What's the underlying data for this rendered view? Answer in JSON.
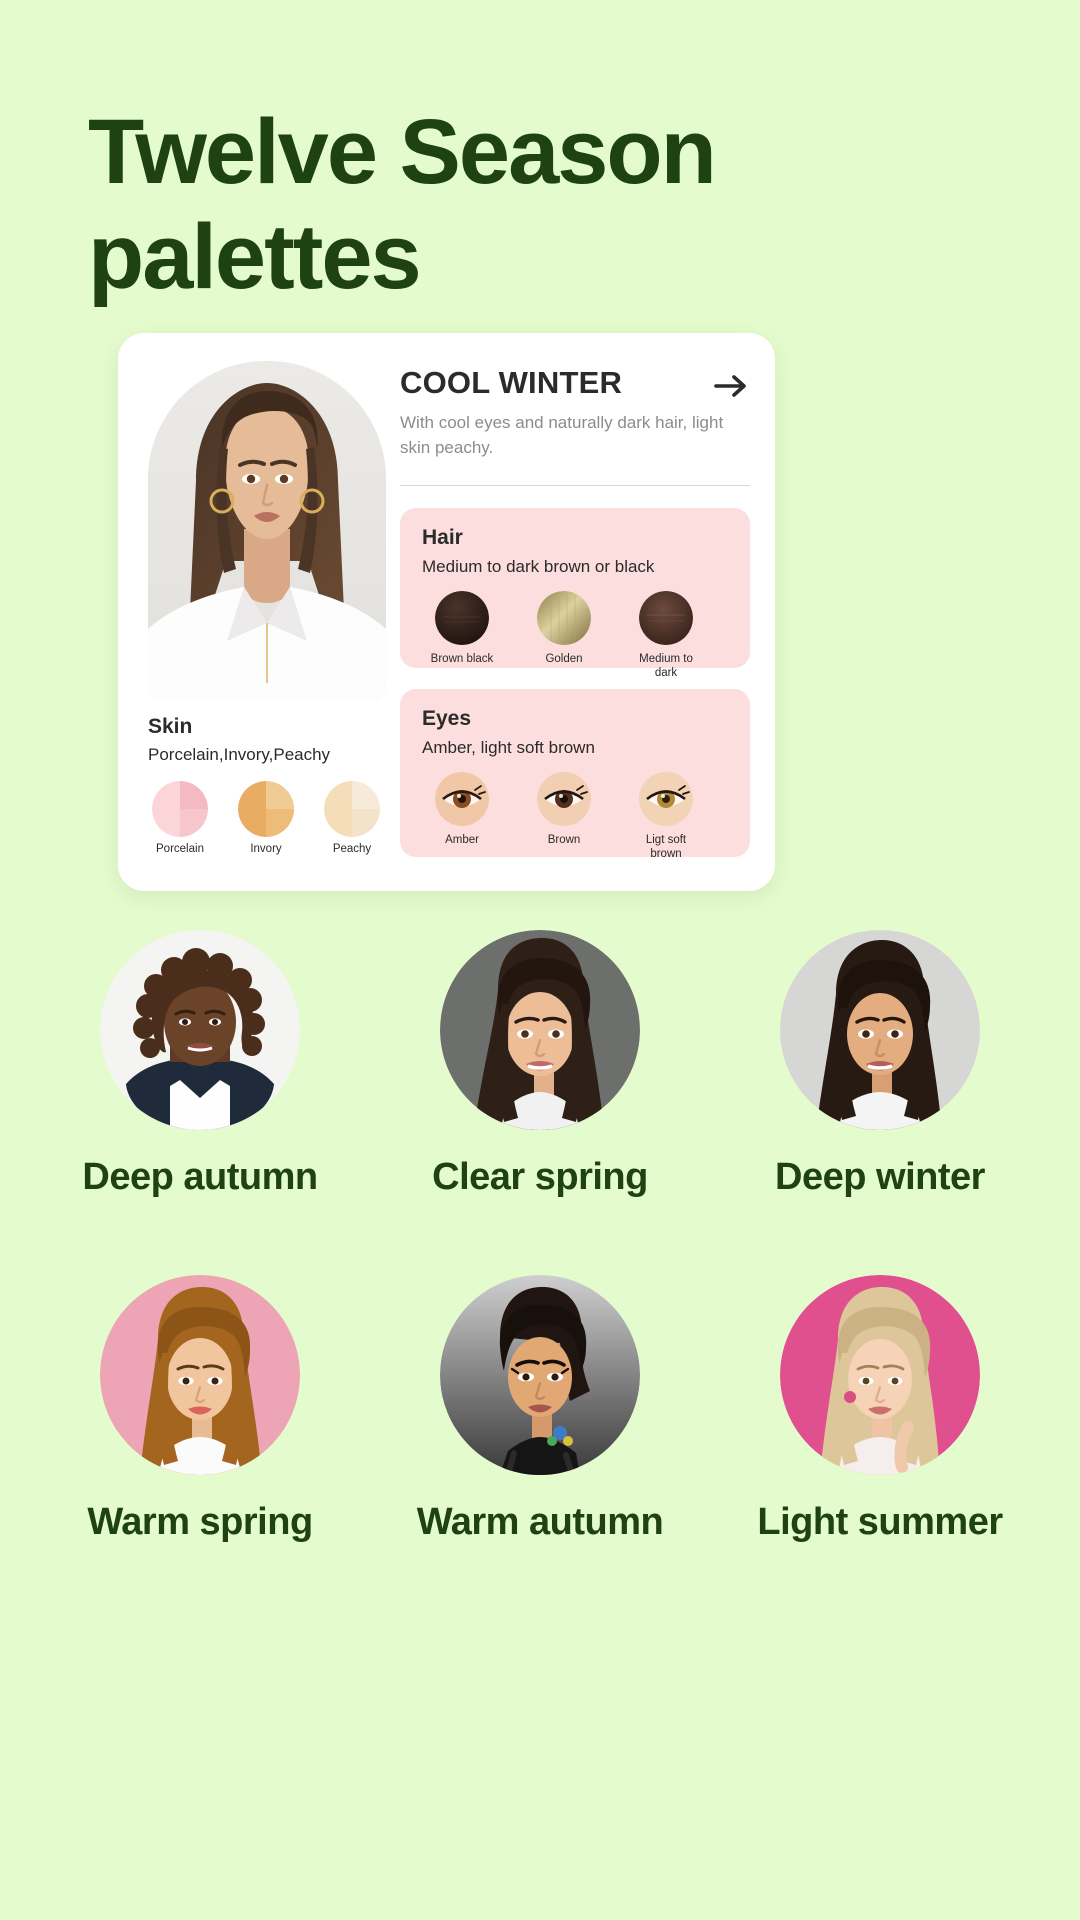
{
  "page": {
    "background_color": "#e4fbcd",
    "title_lines": [
      "Twelve Season",
      "palettes"
    ],
    "title_color": "#1e4212"
  },
  "card": {
    "season_title": "COOL WINTER",
    "arrow_icon": "arrow-right-icon",
    "description": "With cool eyes and naturally dark hair, light skin peachy.",
    "portrait_alt": "cool winter model portrait",
    "hair": {
      "title": "Hair",
      "subtitle": "Medium to dark brown or black",
      "swatches": [
        {
          "label": "Brown black",
          "color": "#2b1b16"
        },
        {
          "label": "Golden",
          "color": "#b3a06a"
        },
        {
          "label": "Medium to dark",
          "color": "#4c2f28"
        }
      ]
    },
    "eyes": {
      "title": "Eyes",
      "subtitle": "Amber, light soft brown",
      "swatches": [
        {
          "label": "Amber",
          "color": "#8a4b20"
        },
        {
          "label": "Brown",
          "color": "#50301e"
        },
        {
          "label": "Ligt soft brown",
          "color": "#a9782f"
        }
      ]
    },
    "skin": {
      "title": "Skin",
      "subtitle": "Porcelain,Invory,Peachy",
      "swatches": [
        {
          "label": "Porcelain",
          "color": "#f6c9cd"
        },
        {
          "label": "Invory",
          "color": "#e8b473"
        },
        {
          "label": "Peachy",
          "color": "#f2dcba"
        }
      ]
    },
    "panel_color": "#fbdedd"
  },
  "seasons": [
    {
      "label": "Deep autumn",
      "bg": "#f3f3f1"
    },
    {
      "label": "Clear spring",
      "bg": "#6d6f6d"
    },
    {
      "label": "Deep winter",
      "bg": "#d6d6d4"
    },
    {
      "label": "Warm spring",
      "bg": "#eda5b5"
    },
    {
      "label": "Warm autumn",
      "bg": "#8d8d8d"
    },
    {
      "label": "Light summer",
      "bg": "#e0508f"
    }
  ]
}
